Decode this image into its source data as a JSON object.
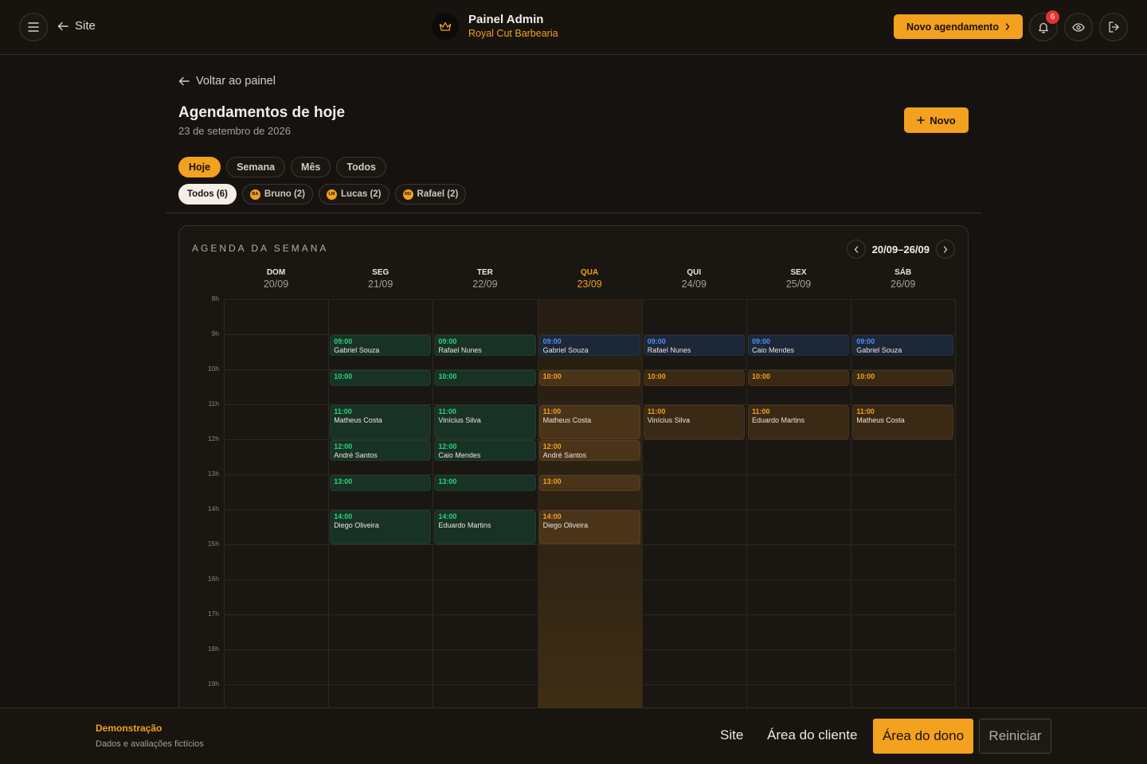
{
  "header": {
    "site_label": "Site",
    "title": "Painel Admin",
    "subtitle": "Royal Cut Barbearia",
    "new_appointment_label": "Novo agendamento",
    "notification_count": "6"
  },
  "page": {
    "back_label": "Voltar ao painel",
    "title": "Agendamentos de hoje",
    "date": "23 de setembro de 2026",
    "new_label": "Novo"
  },
  "filters": {
    "periods": [
      "Hoje",
      "Semana",
      "Mês",
      "Todos"
    ],
    "active_period": "Hoje",
    "barbers": [
      {
        "initials": "",
        "label": "Todos (6)"
      },
      {
        "initials": "BA",
        "label": "Bruno (2)"
      },
      {
        "initials": "LM",
        "label": "Lucas (2)"
      },
      {
        "initials": "RD",
        "label": "Rafael (2)"
      }
    ]
  },
  "calendar": {
    "heading": "AGENDA DA SEMANA",
    "range": "20/09–26/09",
    "days": [
      {
        "name": "DOM",
        "date": "20/09"
      },
      {
        "name": "SEG",
        "date": "21/09"
      },
      {
        "name": "TER",
        "date": "22/09"
      },
      {
        "name": "QUA",
        "date": "23/09",
        "today": true
      },
      {
        "name": "QUI",
        "date": "24/09"
      },
      {
        "name": "SEX",
        "date": "25/09"
      },
      {
        "name": "SÁB",
        "date": "26/09"
      }
    ],
    "hours": [
      "8h",
      "9h",
      "10h",
      "11h",
      "12h",
      "13h",
      "14h",
      "15h",
      "16h",
      "17h",
      "18h",
      "19h"
    ],
    "colors": {
      "past": "#2ed47a",
      "today": "#f3a11f",
      "future": "#4f8ff7"
    },
    "appointments": [
      {
        "day": 1,
        "time": "09:00",
        "name": "Gabriel Souza",
        "hours": 0.6,
        "status": "green"
      },
      {
        "day": 1,
        "time": "10:00",
        "name": "",
        "hours": 0.45,
        "status": "green"
      },
      {
        "day": 1,
        "time": "11:00",
        "name": "Matheus Costa",
        "hours": 0.97,
        "status": "green"
      },
      {
        "day": 1,
        "time": "12:00",
        "name": "André Santos",
        "hours": 0.6,
        "status": "green"
      },
      {
        "day": 1,
        "time": "13:00",
        "name": "",
        "hours": 0.45,
        "status": "green"
      },
      {
        "day": 1,
        "time": "14:00",
        "name": "Diego Oliveira",
        "hours": 0.97,
        "status": "green"
      },
      {
        "day": 2,
        "time": "09:00",
        "name": "Rafael Nunes",
        "hours": 0.6,
        "status": "green"
      },
      {
        "day": 2,
        "time": "10:00",
        "name": "",
        "hours": 0.45,
        "status": "green"
      },
      {
        "day": 2,
        "time": "11:00",
        "name": "Vinícius Silva",
        "hours": 0.97,
        "status": "green"
      },
      {
        "day": 2,
        "time": "12:00",
        "name": "Caio Mendes",
        "hours": 0.6,
        "status": "green"
      },
      {
        "day": 2,
        "time": "13:00",
        "name": "",
        "hours": 0.45,
        "status": "green"
      },
      {
        "day": 2,
        "time": "14:00",
        "name": "Eduardo Martins",
        "hours": 0.97,
        "status": "green"
      },
      {
        "day": 3,
        "time": "09:00",
        "name": "Gabriel Souza",
        "hours": 0.6,
        "status": "blue"
      },
      {
        "day": 3,
        "time": "10:00",
        "name": "",
        "hours": 0.45,
        "status": "orange"
      },
      {
        "day": 3,
        "time": "11:00",
        "name": "Matheus Costa",
        "hours": 0.97,
        "status": "orange"
      },
      {
        "day": 3,
        "time": "12:00",
        "name": "André Santos",
        "hours": 0.6,
        "status": "orange"
      },
      {
        "day": 3,
        "time": "13:00",
        "name": "",
        "hours": 0.45,
        "status": "orange"
      },
      {
        "day": 3,
        "time": "14:00",
        "name": "Diego Oliveira",
        "hours": 0.97,
        "status": "orange"
      },
      {
        "day": 4,
        "time": "09:00",
        "name": "Rafael Nunes",
        "hours": 0.6,
        "status": "blue"
      },
      {
        "day": 4,
        "time": "10:00",
        "name": "",
        "hours": 0.45,
        "status": "orange light"
      },
      {
        "day": 4,
        "time": "11:00",
        "name": "Vinícius Silva",
        "hours": 0.97,
        "status": "orange light"
      },
      {
        "day": 5,
        "time": "09:00",
        "name": "Caio Mendes",
        "hours": 0.6,
        "status": "blue"
      },
      {
        "day": 5,
        "time": "10:00",
        "name": "",
        "hours": 0.45,
        "status": "orange light"
      },
      {
        "day": 5,
        "time": "11:00",
        "name": "Eduardo Martins",
        "hours": 0.97,
        "status": "orange light"
      },
      {
        "day": 6,
        "time": "09:00",
        "name": "Gabriel Souza",
        "hours": 0.6,
        "status": "blue"
      },
      {
        "day": 6,
        "time": "10:00",
        "name": "",
        "hours": 0.45,
        "status": "orange light"
      },
      {
        "day": 6,
        "time": "11:00",
        "name": "Matheus Costa",
        "hours": 0.97,
        "status": "orange light"
      }
    ]
  },
  "footer": {
    "demo_title": "Demonstração",
    "demo_sub": "Dados e avaliações fictícios",
    "site": "Site",
    "client_area": "Área do cliente",
    "owner_area": "Área do dono",
    "reset": "Reiniciar"
  }
}
